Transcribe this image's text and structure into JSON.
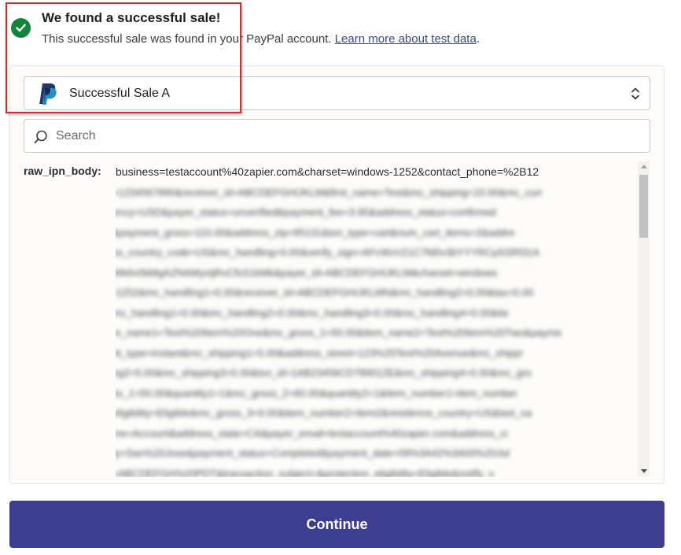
{
  "header": {
    "title": "We found a successful sale!",
    "subtitle": "This successful sale was found in your PayPal account.",
    "link_text": "Learn more about test data",
    "subtitle_end": "."
  },
  "sample_select": {
    "icon": "paypal-logo",
    "selected": "Successful Sale A"
  },
  "search": {
    "placeholder": "Search",
    "value": ""
  },
  "field": {
    "key": "raw_ipn_body:",
    "value_visible": "business=testaccount%40zapier.com&charset=windows-1252&contact_phone=%2B12"
  },
  "continue_label": "Continue",
  "colors": {
    "success_green": "#12843b",
    "link_purple": "#3d4592",
    "button_bg": "#3d3e8f",
    "highlight_red": "#d42b2b"
  }
}
